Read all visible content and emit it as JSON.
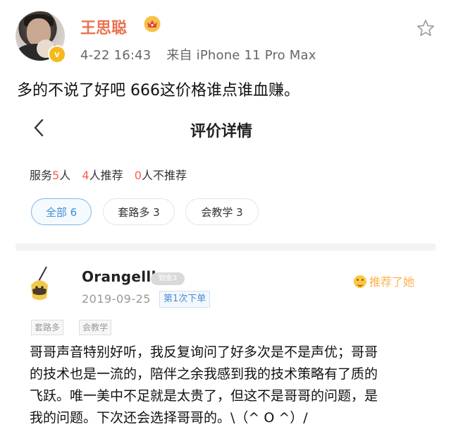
{
  "post": {
    "author": "王思聪",
    "time": "4-22 16:43",
    "source": "来自 iPhone 11 Pro Max",
    "verified_badge": "v",
    "text": "多的不说了好吧 666这价格谁点谁血赚。",
    "icons": [
      "crown-icon",
      "star-icon",
      "verified-badge-icon"
    ]
  },
  "review_screen": {
    "title": "评价详情",
    "stats": {
      "service_label": "服务",
      "service_count": "5",
      "service_unit": "人",
      "recommend_count": "4",
      "recommend_label": "人推荐",
      "not_recommend_count": "0",
      "not_recommend_label": "人不推荐"
    },
    "filters": [
      {
        "label": "全部 6",
        "active": true
      },
      {
        "label": "套路多 3",
        "active": false
      },
      {
        "label": "会教学 3",
        "active": false
      }
    ],
    "review": {
      "user": "Orangelll",
      "level": "铂金3",
      "date": "2019-09-25",
      "order": "第1次下单",
      "recommended": "推荐了她",
      "tags": [
        "套路多",
        "会教学"
      ],
      "text_lines": [
        "哥哥声音特别好听，我反复询问了好多次是不是声优；哥哥",
        "的技术也是一流的，陪伴之余我感到我的技术策略有了质的",
        "飞跃。唯一美中不足就是太贵了，但这不是哥哥的问题，是",
        "我的问题。下次还会选择哥哥的。\\（^ O ^）/"
      ]
    }
  },
  "colors": {
    "username": "#eb7350",
    "accent_blue": "#3d8fd6",
    "count_red": "#ff5a50",
    "recommend_orange": "#ffb24d"
  }
}
